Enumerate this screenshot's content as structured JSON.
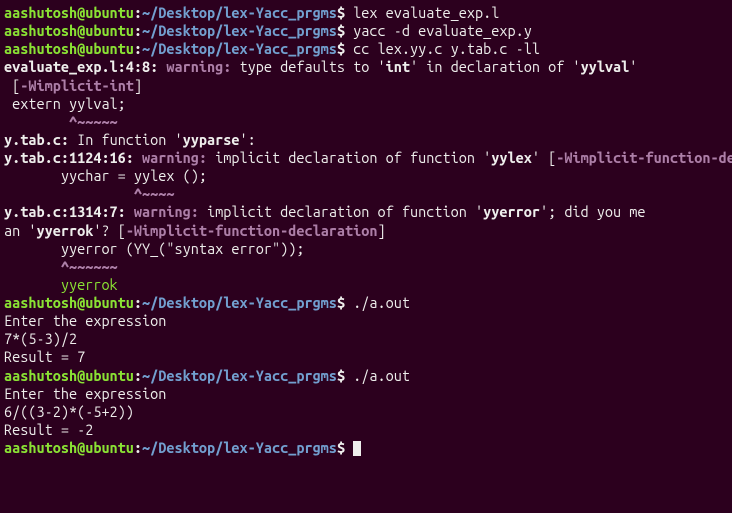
{
  "prompt": {
    "user": "aashutosh@ubuntu",
    "sep": ":",
    "path": "~/Desktop/lex-Yacc_prgms",
    "end": "$"
  },
  "cmd1": " lex evaluate_exp.l",
  "cmd2": " yacc -d evaluate_exp.y",
  "cmd3": " cc lex.yy.c y.tab.c -ll",
  "warn1": {
    "loc": "evaluate_exp.l:4:8:",
    "w": " warning: ",
    "msg1": "type defaults to '",
    "int": "int",
    "msg2": "' in declaration of '",
    "yylval": "yylval",
    "msg3": "'"
  },
  "flag1a": " [",
  "flag1b": "-Wimplicit-int",
  "flag1c": "]",
  "extern": " extern yylval;",
  "caret1": "        ^~~~~~",
  "infunc1": "y.tab.c:",
  "infunc2": " In function '",
  "infunc3": "yyparse",
  "infunc4": "':",
  "warn2": {
    "loc": "y.tab.c:1124:16:",
    "w": " warning: ",
    "msg1": "implicit declaration of function '",
    "fn": "yylex",
    "msg2": "' [",
    "flag": "-Wimplicit-function-declaration",
    "close": "]"
  },
  "code2": "       yychar = yylex ();",
  "caret2": "                ^~~~~",
  "warn3": {
    "loc": "y.tab.c:1314:7:",
    "w": " warning: ",
    "msg1": "implicit declaration of function '",
    "fn": "yyerror",
    "msg2": "'; did you me"
  },
  "warn3b1": "an '",
  "warn3b2": "yyerrok",
  "warn3b3": "'? [",
  "warn3bflag": "-Wimplicit-function-declaration",
  "warn3bclose": "]",
  "code3": "       yyerror (YY_(\"syntax error\"));",
  "caret3": "       ^~~~~~~",
  "suggest": "       yyerrok",
  "run1": " ./a.out",
  "prompt_text": "Enter the expression",
  "input1": "7*(5-3)/2",
  "result1": "Result = 7",
  "run2": " ./a.out",
  "input2": "6/((3-2)*(-5+2))",
  "result2": "Result = -2",
  "blank_cmd": " "
}
